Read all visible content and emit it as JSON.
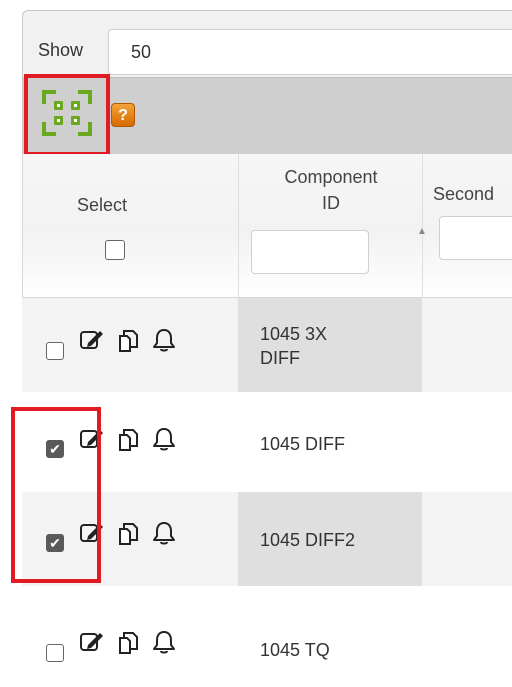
{
  "show": {
    "label": "Show",
    "value": "50"
  },
  "toolbar": {
    "qr_icon": "qr-scan-icon",
    "help_icon": "help-icon",
    "help_label": "?"
  },
  "table": {
    "headers": {
      "select": "Select",
      "component_line1": "Component",
      "component_line2": "ID",
      "second": "Second"
    },
    "rows": [
      {
        "component_line1": "1045 3X",
        "component_line2": "DIFF",
        "checked": false
      },
      {
        "component_line1": "1045 DIFF",
        "component_line2": "",
        "checked": true
      },
      {
        "component_line1": "1045 DIFF2",
        "component_line2": "",
        "checked": true
      },
      {
        "component_line1": "1045 TQ",
        "component_line2": "",
        "checked": false
      }
    ],
    "row_icons": [
      "edit-icon",
      "copy-icon",
      "bell-icon"
    ]
  },
  "colors": {
    "highlight": "#e01b24",
    "qr_green": "#6aa820",
    "help_orange": "#e8830f"
  }
}
